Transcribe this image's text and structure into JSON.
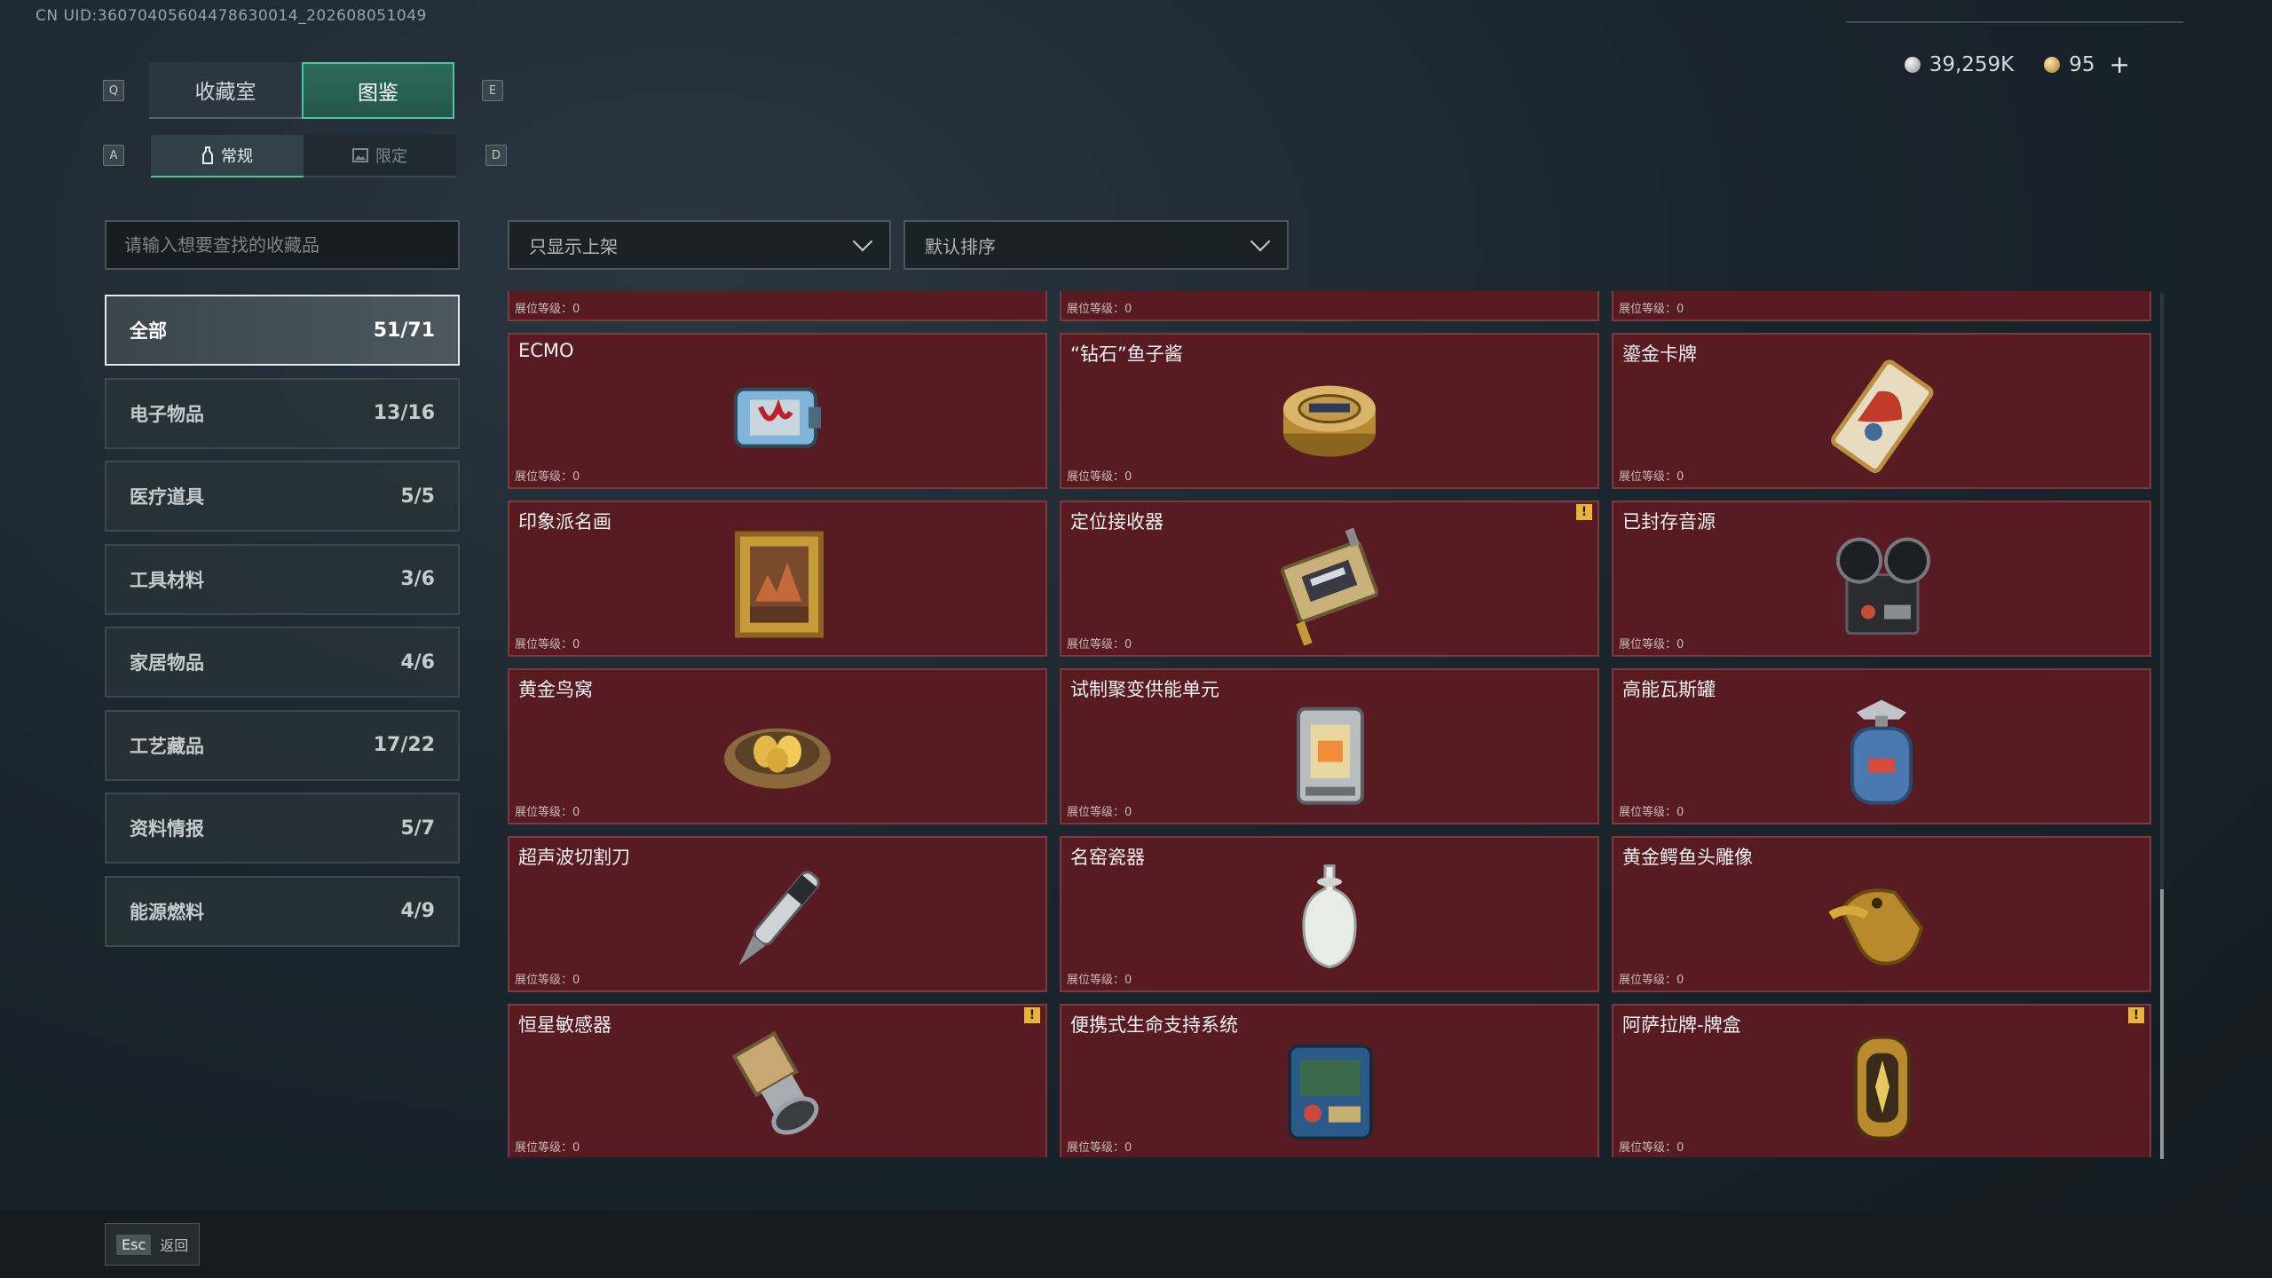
{
  "uid": "CN UID:36070405604478630014_202608051049",
  "currency": {
    "silver": "39,259K",
    "gold": "95",
    "plus": "+"
  },
  "keys": {
    "q": "Q",
    "e": "E",
    "a": "A",
    "d": "D"
  },
  "tabs": [
    {
      "label": "收藏室"
    },
    {
      "label": "图鉴"
    }
  ],
  "subtabs": [
    {
      "label": "常规"
    },
    {
      "label": "限定"
    }
  ],
  "search": {
    "placeholder": "请输入想要查找的收藏品"
  },
  "filters": {
    "shelf": "只显示上架",
    "sort": "默认排序"
  },
  "categories": [
    {
      "label": "全部",
      "count": "51/71"
    },
    {
      "label": "电子物品",
      "count": "13/16"
    },
    {
      "label": "医疗道具",
      "count": "5/5"
    },
    {
      "label": "工具材料",
      "count": "3/6"
    },
    {
      "label": "家居物品",
      "count": "4/6"
    },
    {
      "label": "工艺藏品",
      "count": "17/22"
    },
    {
      "label": "资料情报",
      "count": "5/7"
    },
    {
      "label": "能源燃料",
      "count": "4/9"
    }
  ],
  "level_label": "展位等级：0",
  "items": [
    {
      "name": "",
      "icon": "partial-item-icon",
      "warn": false
    },
    {
      "name": "",
      "icon": "partial-item-icon",
      "warn": false
    },
    {
      "name": "",
      "icon": "partial-item-icon",
      "warn": false
    },
    {
      "name": "ECMO",
      "icon": "ecmo-machine-icon",
      "warn": false
    },
    {
      "name": "“钻石”鱼子酱",
      "icon": "caviar-tin-icon",
      "warn": false
    },
    {
      "name": "鎏金卡牌",
      "icon": "gilded-card-icon",
      "warn": false
    },
    {
      "name": "印象派名画",
      "icon": "framed-painting-icon",
      "warn": false
    },
    {
      "name": "定位接收器",
      "icon": "locator-receiver-icon",
      "warn": true
    },
    {
      "name": "已封存音源",
      "icon": "reel-tape-recorder-icon",
      "warn": false
    },
    {
      "name": "黄金鸟窝",
      "icon": "golden-nest-icon",
      "warn": false
    },
    {
      "name": "试制聚变供能单元",
      "icon": "fusion-unit-icon",
      "warn": false
    },
    {
      "name": "高能瓦斯罐",
      "icon": "gas-canister-icon",
      "warn": false
    },
    {
      "name": "超声波切割刀",
      "icon": "ultrasonic-cutter-icon",
      "warn": false
    },
    {
      "name": "名窑瓷器",
      "icon": "porcelain-vase-icon",
      "warn": false
    },
    {
      "name": "黄金鳄鱼头雕像",
      "icon": "golden-crocodile-icon",
      "warn": false
    },
    {
      "name": "恒星敏感器",
      "icon": "star-sensor-icon",
      "warn": true
    },
    {
      "name": "便携式生命支持系统",
      "icon": "life-support-icon",
      "warn": false
    },
    {
      "name": "阿萨拉牌-牌盒",
      "icon": "card-box-icon",
      "warn": true
    }
  ],
  "warn_symbol": "!",
  "footer": {
    "key": "Esc",
    "label": "返回"
  }
}
